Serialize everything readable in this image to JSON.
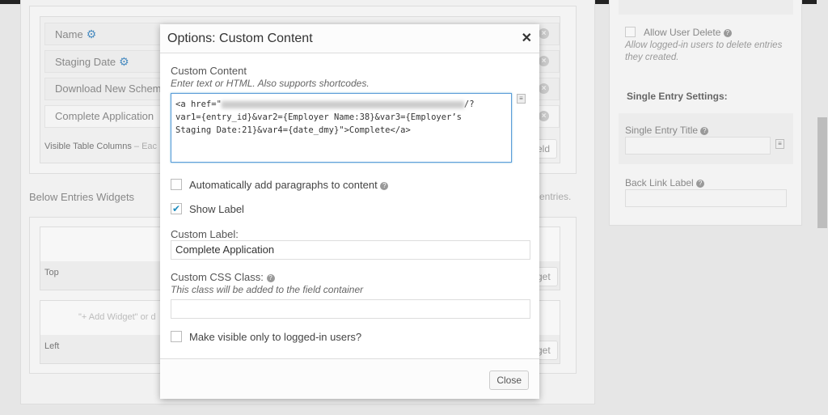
{
  "fields": [
    {
      "label": "Name",
      "gear": true
    },
    {
      "label": "Staging Date",
      "gear": true
    },
    {
      "label": "Download New Scheme",
      "gear": false
    },
    {
      "label": "Complete Application",
      "gear": false
    }
  ],
  "visible_columns": {
    "label": "Visible Table Columns",
    "desc": "– Eac",
    "add_button": "eld"
  },
  "below_widgets": {
    "title": "Below Entries Widgets",
    "tail": "entries.",
    "top": "Top",
    "left": "Left",
    "add_hint": "\"+ Add Widget\" or d",
    "add_widget": "get"
  },
  "sidebar": {
    "allow_delete": "Allow User Delete",
    "allow_delete_desc": "Allow logged-in users to delete entries they created.",
    "single_heading": "Single Entry Settings:",
    "single_title": "Single Entry Title",
    "back_link": "Back Link Label"
  },
  "modal": {
    "title": "Options: Custom Content",
    "close_x": "✕",
    "content_label": "Custom Content",
    "content_desc": "Enter text or HTML. Also supports shortcodes.",
    "content_prefix": "<a href=\"",
    "content_after_url": "/?\nvar1={entry_id}&var2={Employer Name:38}&var3={Employer’s\nStaging Date:21}&var4={date_dmy}\">Complete</a>",
    "auto_p": "Automatically add paragraphs to content",
    "auto_p_checked": false,
    "show_label": "Show Label",
    "show_label_checked": true,
    "custom_label": "Custom Label:",
    "custom_label_value": "Complete Application",
    "css_label": "Custom CSS Class:",
    "css_desc": "This class will be added to the field container",
    "css_value": "",
    "logged_in": "Make visible only to logged-in users?",
    "logged_in_checked": false,
    "close_button": "Close"
  }
}
